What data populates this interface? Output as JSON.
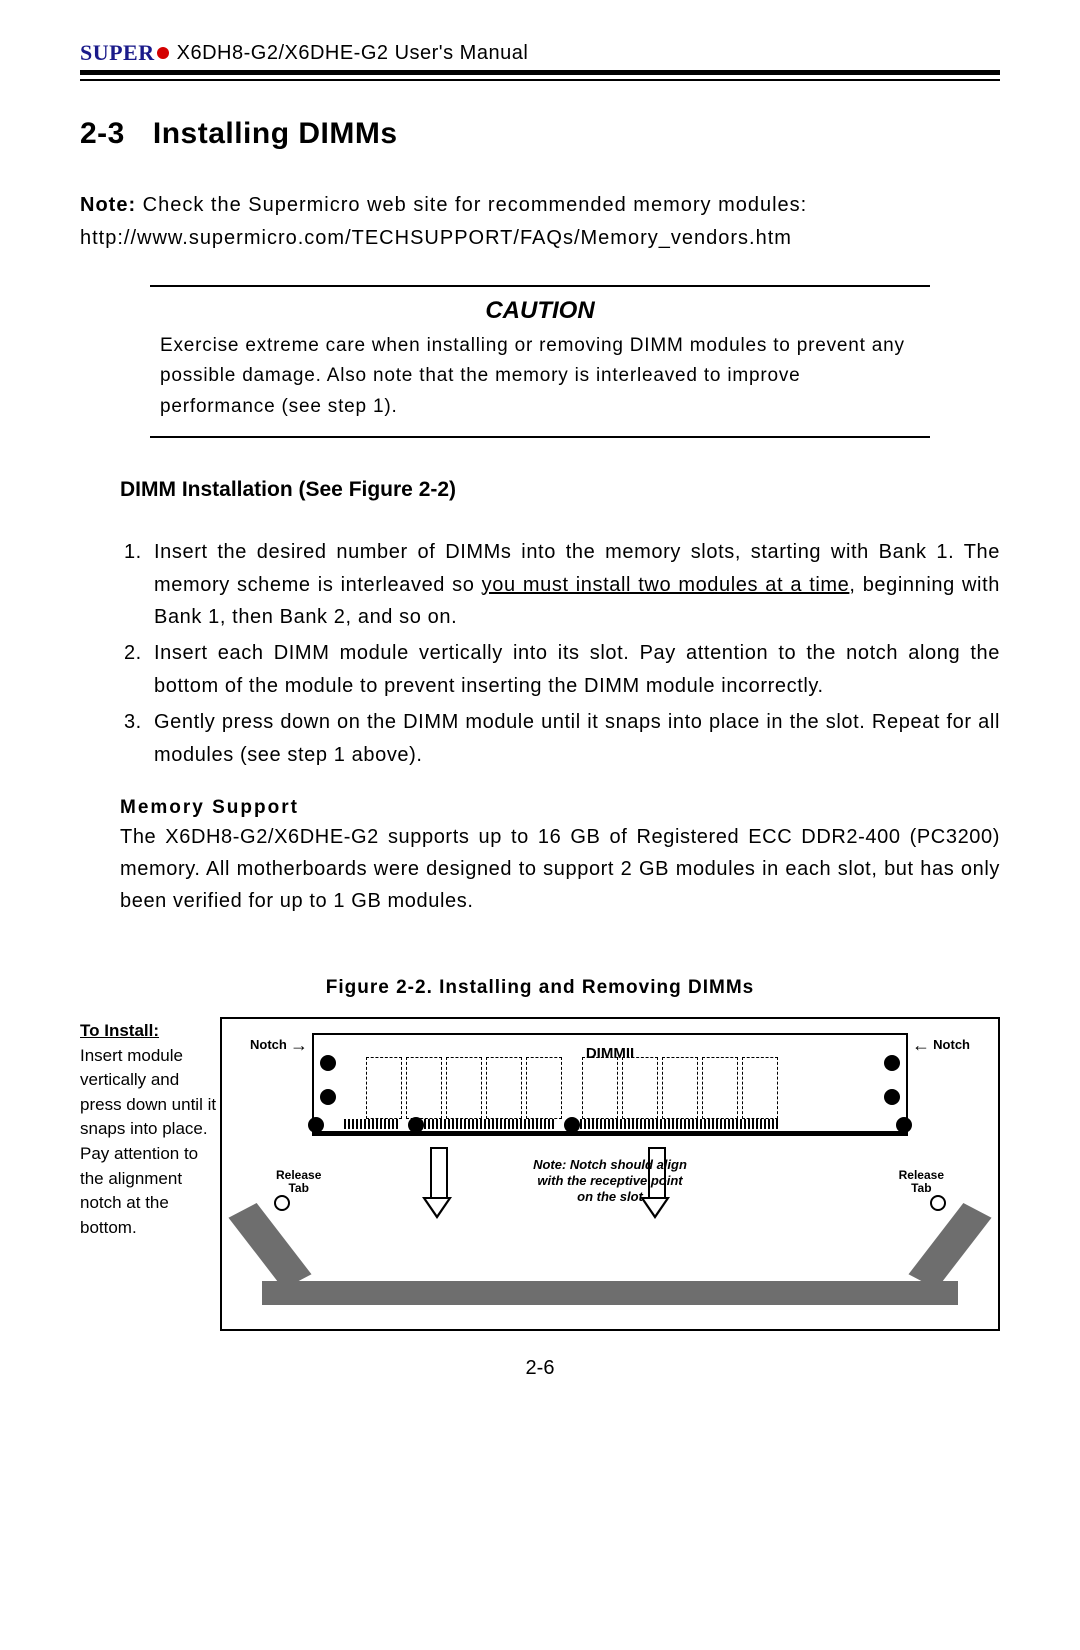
{
  "header": {
    "brand": "SUPER",
    "title": "X6DH8-G2/X6DHE-G2 User's Manual"
  },
  "section": {
    "number": "2-3",
    "title": "Installing DIMMs"
  },
  "note": {
    "label": "Note:",
    "text": " Check the Supermicro web site for recommended memory modules: http://www.supermicro.com/TECHSUPPORT/FAQs/Memory_vendors.htm"
  },
  "caution": {
    "title": "CAUTION",
    "text": "Exercise extreme care when installing or removing DIMM modules to prevent any possible damage.  Also note that the memory is interleaved to improve performance (see step 1)."
  },
  "subheading": "DIMM Installation (See Figure 2-2)",
  "steps": {
    "s1a": "Insert the desired number of DIMMs into the memory slots, starting with Bank 1.  The memory scheme is interleaved so ",
    "s1u": "you must install two modules at a time",
    "s1b": ", beginning with Bank 1, then Bank 2, and so on.",
    "s2": "Insert each DIMM module vertically into its slot.  Pay attention to the notch along the bottom of the module to prevent inserting the DIMM module incorrectly.",
    "s3": "Gently press down on the DIMM module until it snaps into place in the slot.  Repeat for all modules (see step 1 above)."
  },
  "memory": {
    "heading": "Memory Support",
    "body": "The X6DH8-G2/X6DHE-G2 supports up to 16 GB of Registered ECC DDR2-400 (PC3200) memory.  All motherboards were designed to support 2 GB modules in each slot, but has only been verified for up to 1 GB modules."
  },
  "figure": {
    "caption": "Figure 2-2.  Installing and Removing DIMMs",
    "install_head": "To Install:",
    "install_text": "Insert module vertically and press down until it snaps into place. Pay attention to the alignment notch at the bottom.",
    "dimm_label": "DIMMII",
    "notch": "Notch",
    "release": "Release\nTab",
    "note": "Note: Notch should align with the receptive point on the slot"
  },
  "page_number": "2-6"
}
